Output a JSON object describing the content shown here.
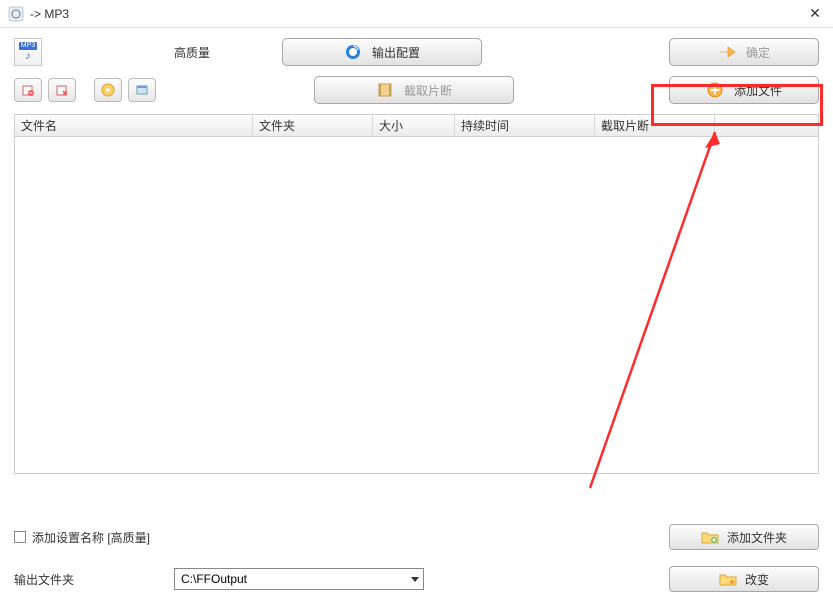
{
  "window": {
    "title": " -> MP3"
  },
  "top": {
    "mp3_tag": "MP3",
    "quality_label": "高质量",
    "output_config": "输出配置",
    "ok": "确定",
    "clip": "截取片断",
    "add_file": "添加文件"
  },
  "table": {
    "headers": {
      "filename": "文件名",
      "folder": "文件夹",
      "size": "大小",
      "duration": "持续时间",
      "clip": "截取片断"
    }
  },
  "bottom": {
    "add_settings_name": "添加设置名称 [高质量]",
    "output_folder_label": "输出文件夹",
    "output_folder_value": "C:\\FFOutput",
    "add_folder": "添加文件夹",
    "change": "改变"
  }
}
